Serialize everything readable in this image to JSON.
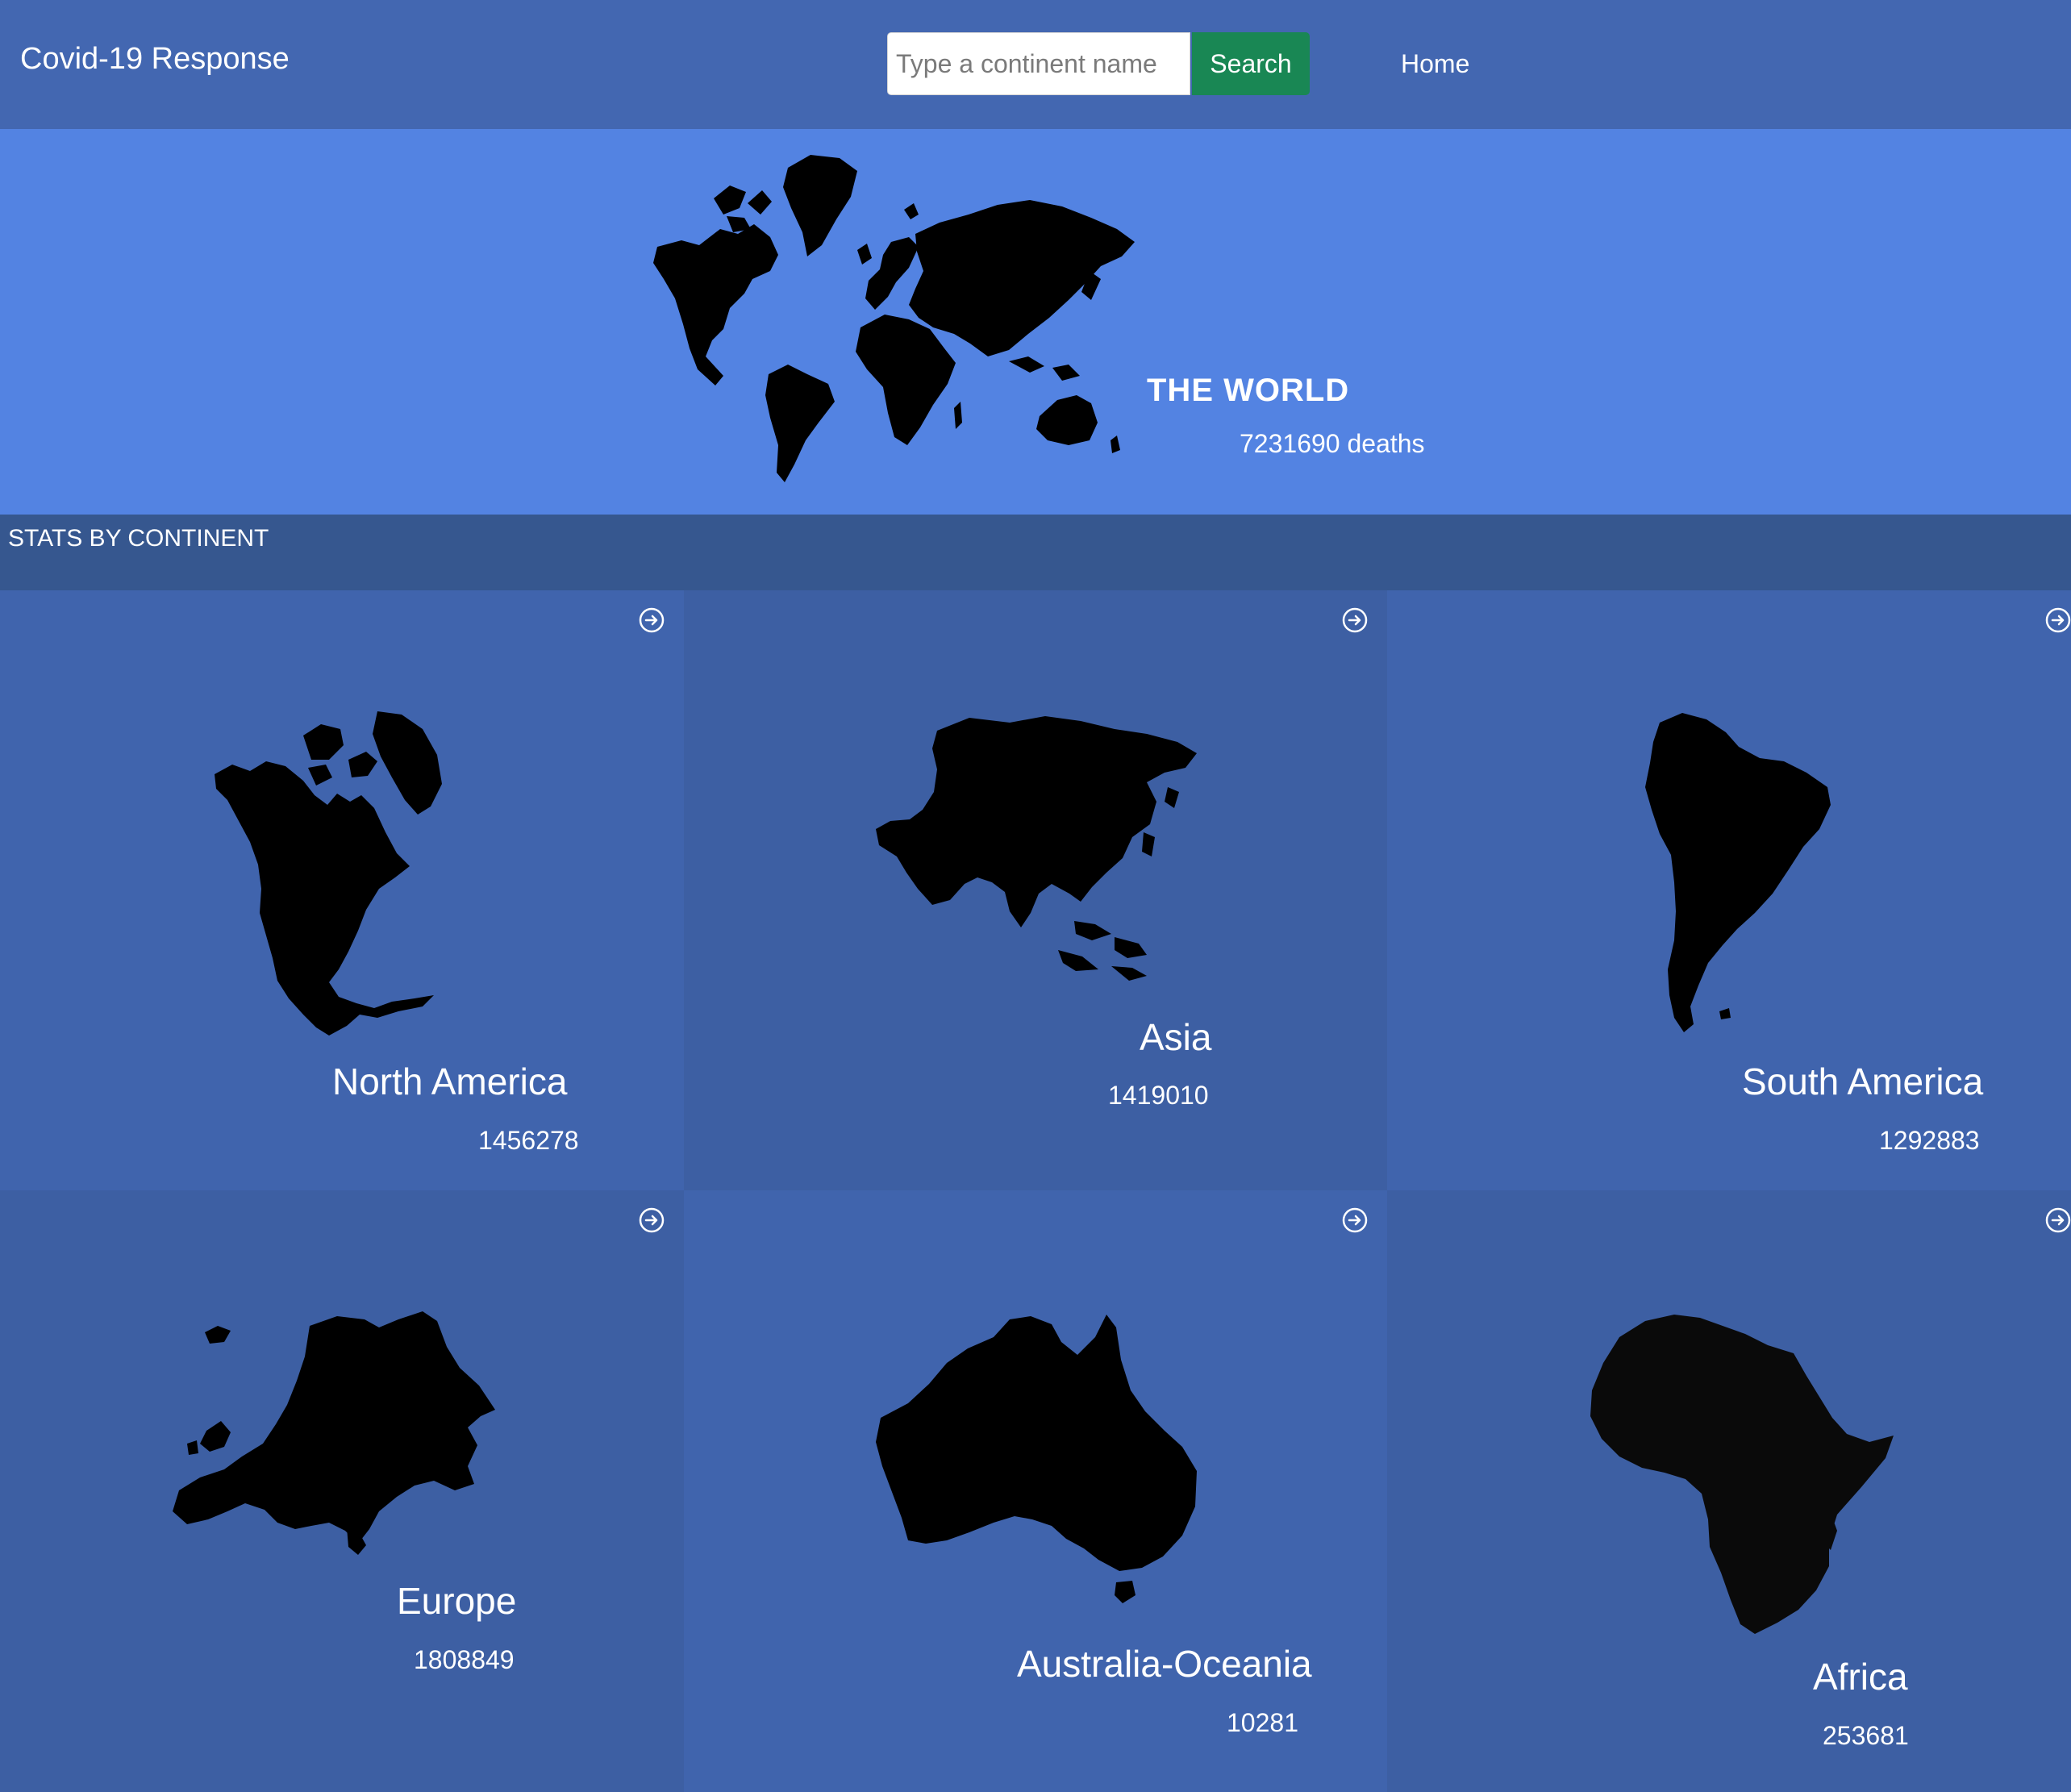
{
  "navbar": {
    "brand": "Covid-19 Response",
    "search_placeholder": "Type a continent name",
    "search_value": "",
    "search_button": "Search",
    "home_link": "Home"
  },
  "world": {
    "title": "THE WORLD",
    "deaths": "7231690 deaths"
  },
  "section": {
    "title": "STATS BY CONTINENT"
  },
  "continents": [
    {
      "name": "North America",
      "count": "1456278",
      "icon": "north-america-map"
    },
    {
      "name": "Asia",
      "count": "1419010",
      "icon": "asia-map"
    },
    {
      "name": "South America",
      "count": "1292883",
      "icon": "south-america-map"
    },
    {
      "name": "Europe",
      "count": "1808849",
      "icon": "europe-map"
    },
    {
      "name": "Australia-Oceania",
      "count": "10281",
      "icon": "australia-map"
    },
    {
      "name": "Africa",
      "count": "253681",
      "icon": "africa-map"
    }
  ],
  "colors": {
    "navbar": "#4367b1",
    "hero": "#5383e2",
    "section_header": "#36578f",
    "search_button": "#198754",
    "card_a": "#4064ad",
    "card_b": "#3d5fa3"
  }
}
